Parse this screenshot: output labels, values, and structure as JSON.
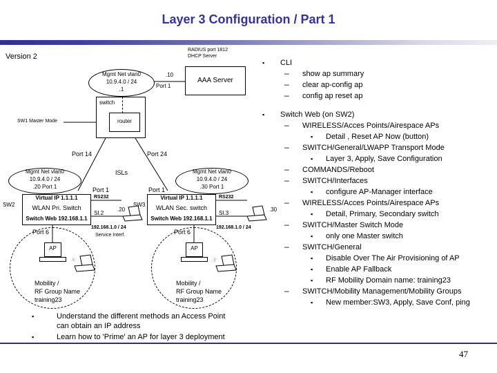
{
  "slide": {
    "title": "Layer 3 Configuration / Part 1",
    "version": "Version 2",
    "page_number": "47",
    "accent_color": "#333399",
    "rule_color": "#2e3192",
    "highlight_color": "#d98c8c"
  },
  "diagram": {
    "aaa_note_line1": "RADIUS port 1812",
    "aaa_note_line2": "DHCP Server",
    "aaa_server": "AAA Server",
    "aaa_ip": ".10",
    "aaa_port": "Port 1",
    "mgmt_top": {
      "line1": "Mgmt Net vlan0",
      "line2": "10.9.4.0 / 24",
      "line3": ".1"
    },
    "switch_box": "switch",
    "router_box": "router",
    "master_mode": "SW1 Master Mode",
    "port14": "Port 14",
    "port24": "Port 24",
    "isls": "ISLs",
    "left": {
      "device_label": "SW2",
      "mgmt_line1": "Mgmt Net vlan0",
      "mgmt_line2": "10.9.4.0 / 24",
      "mgmt_line3": ".20 Port 1",
      "box_line1": "Virtual IP 1.1.1.1",
      "box_line2": "WLAN Pri. Switch",
      "box_line3": "Switch Web 192.168.1.1",
      "port1": "Port 1",
      "rs232": "RS232",
      "si": "SI.2",
      "si_ip": ".20",
      "subnet": "192.168.1.0 / 24",
      "service": "Service Interf.",
      "port6": "Port 6",
      "ap": "AP",
      "client": ".x",
      "group_line1": "Mobility /",
      "group_line2": "RF Group Name",
      "group_line3": "training23"
    },
    "right": {
      "device_label": "SW3",
      "mgmt_line1": "Mgmt Net vlan0",
      "mgmt_line2": "10.9.4.0 / 24",
      "mgmt_line3": ".30 Port 1",
      "box_line1": "Virtual IP 1.1.1.1",
      "box_line2": "WLAN Sec. switch",
      "box_line3": "Switch Web 192.168.1.1",
      "port1": "Port 1",
      "rs232": "RS232",
      "si": "SI.3",
      "si_ip": ".30",
      "subnet": "192.168.1.0 / 24",
      "port6": "Port 6",
      "ap": "AP",
      "client": ".y",
      "group_line1": "Mobility /",
      "group_line2": "RF Group Name",
      "group_line3": "training23"
    }
  },
  "right_column": {
    "cli_heading": "CLI",
    "cli_items": [
      "show ap summary",
      "clear ap-config ap",
      "config ap reset ap"
    ],
    "web_heading": "Switch Web (on SW2)",
    "web_items": [
      {
        "label": "WIRELESS/Acces Points/Airespace APs",
        "sub": [
          "Detail , Reset AP Now (button)"
        ]
      },
      {
        "label": "SWITCH/General/LWAPP Transport Mode",
        "sub": [
          "Layer 3, Apply, Save Configuration"
        ]
      },
      {
        "label": "COMMANDS/Reboot",
        "sub": []
      },
      {
        "label": "SWITCH/Interfaces",
        "sub": [
          "configure AP-Manager interface"
        ]
      },
      {
        "label": "WIRELESS/Acces Points/Airespace APs",
        "sub": [
          "Detail, Primary, Secondary switch"
        ]
      },
      {
        "label": "SWITCH/Master Switch Mode",
        "sub": [
          "only one Master switch"
        ]
      },
      {
        "label": "SWITCH/General",
        "sub": [
          "Disable Over The Air Provisioning of AP",
          "Enable AP Fallback",
          "RF Mobility Domain name: training23"
        ]
      },
      {
        "label": "SWITCH/Mobility Management/Mobility Groups",
        "sub": [
          "New member:SW3, Apply, Save Conf, ping"
        ]
      }
    ]
  },
  "bottom_bullets": [
    "Understand the different methods an Access Point\ncan obtain an IP address",
    "Learn how to 'Prime' an AP for layer 3 deployment"
  ],
  "markers": {
    "square": "▪",
    "dash": "–"
  }
}
